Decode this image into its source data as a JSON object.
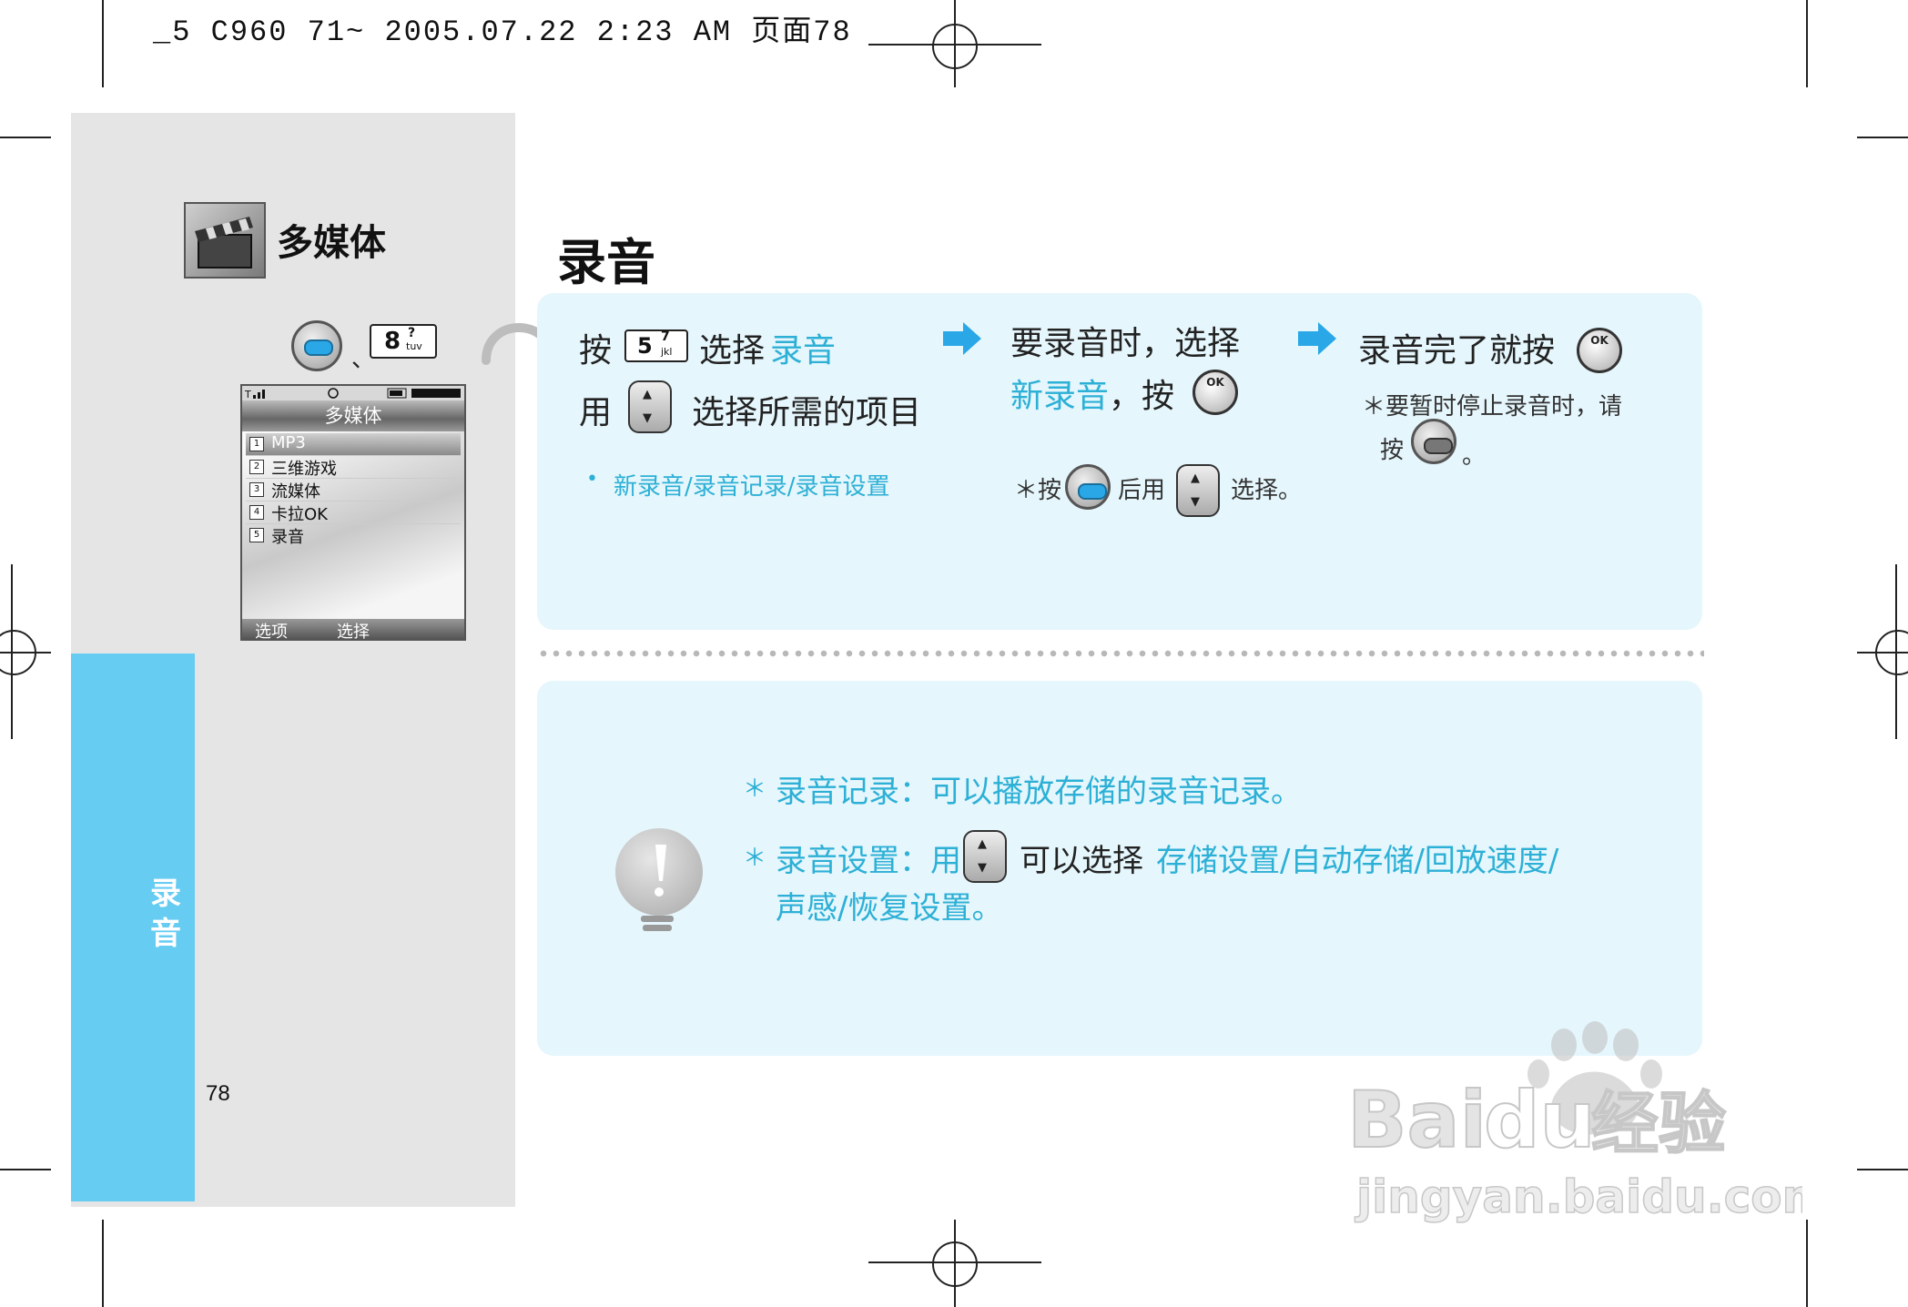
{
  "header": {
    "print_line": "_5 C960 71~ 2005.07.22 2:23 AM 页面78"
  },
  "sidebar": {
    "title": "多媒体",
    "tab_label": "录音",
    "page_number": "78",
    "key_separator": "、",
    "key8_digit": "8",
    "key8_letters": "tuv",
    "key8_symbol": "?"
  },
  "phone_screen": {
    "title": "多媒体",
    "items": [
      {
        "num": "1",
        "label": "MP3"
      },
      {
        "num": "2",
        "label": "三维游戏"
      },
      {
        "num": "3",
        "label": "流媒体"
      },
      {
        "num": "4",
        "label": "卡拉OK"
      },
      {
        "num": "5",
        "label": "录音"
      }
    ],
    "soft_left": "选项",
    "soft_right": "选择"
  },
  "main": {
    "section_title": "录音",
    "step1": {
      "press": "按",
      "key5_digit": "5",
      "key5_letters": "jkl",
      "key5_symbol": "7",
      "select": "选择",
      "select_target": "录音",
      "use": "用",
      "choose": "选择所需的项目",
      "bullet": "新录音/录音记录/录音设置"
    },
    "step2": {
      "line1": "要录音时，选择",
      "target": "新录音",
      "line2": "，按",
      "note_press": "＊按",
      "note_then": "后用",
      "note_select": "选择。"
    },
    "step3": {
      "line1": "录音完了就按",
      "note1": "＊要暂时停止录音时，请",
      "note2": "按",
      "note3": "。"
    },
    "ok_label": "OK"
  },
  "notes": {
    "n1_star": "＊",
    "n1": "录音记录：可以播放存储的录音记录。",
    "n2_star": "＊",
    "n2_head": "录音设置：用",
    "n2_mid": "可以选择",
    "n2_opts": "存储设置/自动存储/回放速度/",
    "n2_line2": "声感/恢复设置。"
  },
  "watermark": {
    "brand": "Bai",
    "brand2": "du",
    "brand3": "经验",
    "url": "jingyan.baidu.com"
  },
  "colors": {
    "accent_cyan": "#2db0d6",
    "tab_blue": "#66ccf2",
    "box_bg": "#e5f6fc",
    "arrow": "#2aa7e6"
  }
}
